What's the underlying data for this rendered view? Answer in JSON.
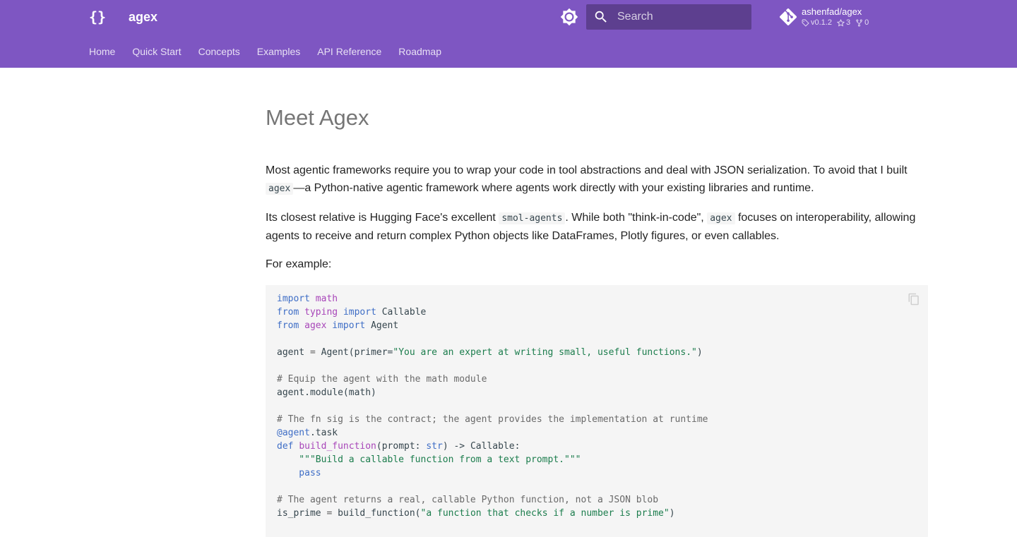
{
  "header": {
    "logo_text": "{}",
    "site_title": "agex",
    "search_placeholder": "Search",
    "repo": {
      "name": "ashenfad/agex",
      "version": "v0.1.2",
      "stars": "3",
      "forks": "0"
    }
  },
  "tabs": [
    {
      "label": "Home"
    },
    {
      "label": "Quick Start"
    },
    {
      "label": "Concepts"
    },
    {
      "label": "Examples"
    },
    {
      "label": "API Reference"
    },
    {
      "label": "Roadmap"
    }
  ],
  "page": {
    "title": "Meet Agex",
    "p1_a": "Most agentic frameworks require you to wrap your code in tool abstractions and deal with JSON serialization. To avoid that I built ",
    "p1_code": "agex",
    "p1_b": "—a Python-native agentic framework where agents work directly with your existing libraries and runtime.",
    "p2_a": "Its closest relative is Hugging Face's excellent ",
    "p2_code1": "smol-agents",
    "p2_b": ". While both \"think-in-code\", ",
    "p2_code2": "agex",
    "p2_c": " focuses on interoperability, allowing agents to receive and return complex Python objects like DataFrames, Plotly figures, or even callables.",
    "p3": "For example:"
  },
  "code": {
    "l1_kw": "import",
    "l1_mod": "math",
    "l2_kw1": "from",
    "l2_mod": "typing",
    "l2_kw2": "import",
    "l2_name": "Callable",
    "l3_kw1": "from",
    "l3_mod": "agex",
    "l3_kw2": "import",
    "l3_name": "Agent",
    "l5_a": "agent",
    "l5_eq": " = ",
    "l5_b": "Agent(primer=",
    "l5_str": "\"You are an expert at writing small, useful functions.\"",
    "l5_c": ")",
    "l7_cm": "# Equip the agent with the math module",
    "l8": "agent.module(math)",
    "l10_cm": "# The fn sig is the contract; the agent provides the implementation at runtime",
    "l11_dec": "@agent",
    "l11_b": ".task",
    "l12_kw": "def",
    "l12_fn": "build_function",
    "l12_a": "(prompt: ",
    "l12_type": "str",
    "l12_b": ") -> Callable:",
    "l13_str": "    \"\"\"Build a callable function from a text prompt.\"\"\"",
    "l14_kw": "    pass",
    "l16_cm": "# The agent returns a real, callable Python function, not a JSON blob",
    "l17_a": "is_prime",
    "l17_eq": " = ",
    "l17_b": "build_function(",
    "l17_str": "\"a function that checks if a number is prime\"",
    "l17_c": ")"
  },
  "colors": {
    "primary": "#7e56c2",
    "code_bg": "#f5f5f5"
  }
}
